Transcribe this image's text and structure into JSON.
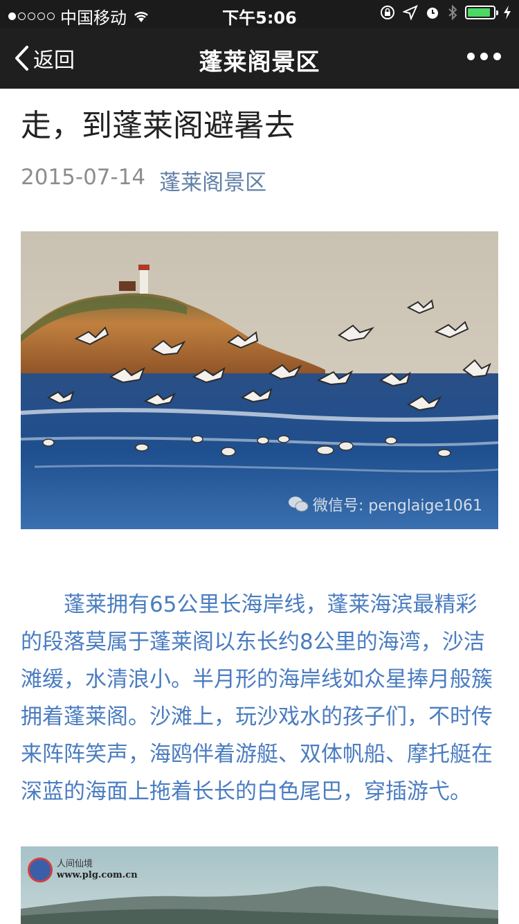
{
  "status_bar": {
    "carrier": "中国移动",
    "time": "下午5:06",
    "signal_icon": "signal-dots-icon",
    "wifi_icon": "wifi-icon",
    "battery_level": 0.9,
    "battery_color": "#4cd964"
  },
  "nav": {
    "back_label": "返回",
    "title": "蓬莱阁景区",
    "more_icon": "more-dots-icon"
  },
  "article": {
    "title": "走，到蓬莱阁避暑去",
    "date": "2015-07-14",
    "account": "蓬莱阁景区",
    "photo1_watermark": "微信号: penglaige1061",
    "paragraph": "蓬莱拥有65公里长海岸线，蓬莱海滨最精彩的段落莫属于蓬莱阁以东长约8公里的海湾，沙洁滩缓，水清浪小。半月形的海岸线如众星捧月般簇拥着蓬莱阁。沙滩上，玩沙戏水的孩子们，不时传来阵阵笑声，海鸥伴着游艇、双体帆船、摩托艇在深蓝的海面上拖着长长的白色尾巴，穿插游弋。",
    "photo2_logo_title": "人间仙境",
    "photo2_logo_url": "www.plg.com.cn"
  },
  "colors": {
    "link": "#607fa6",
    "paragraph": "#4a7cc0",
    "navbar": "#1f1f1f"
  }
}
